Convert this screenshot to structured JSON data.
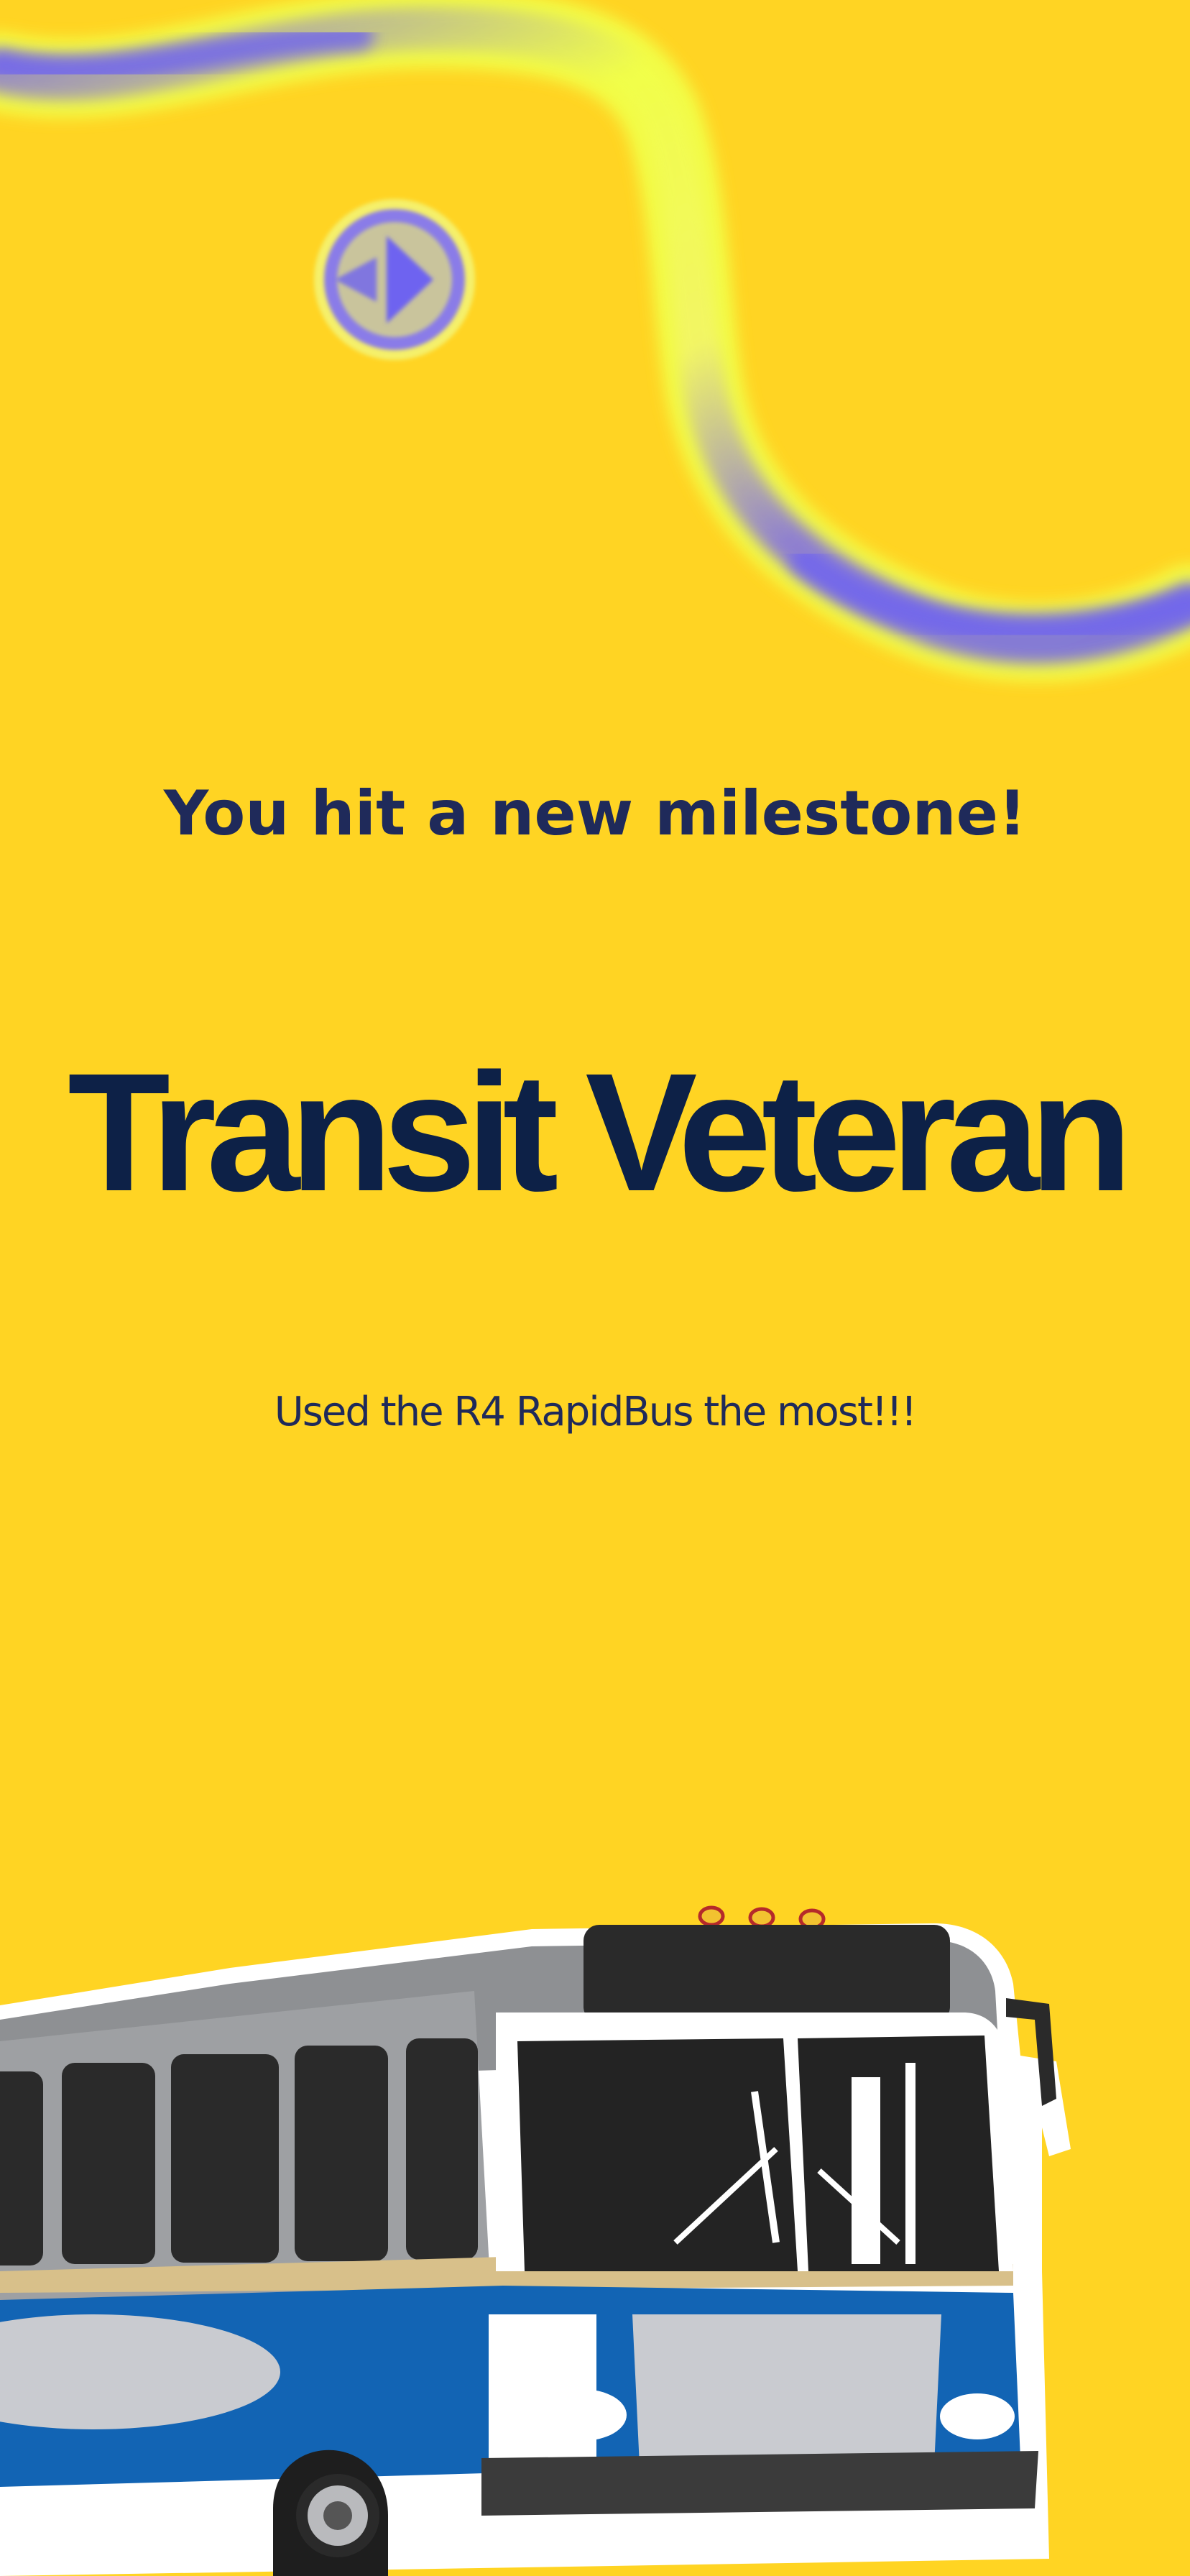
{
  "milestone": {
    "subtitle": "You hit a new milestone!",
    "title": "Transit Veteran",
    "caption": "Used the R4 RapidBus the most!!!"
  },
  "colors": {
    "background": "#FFD423",
    "subtitle": "#1F2A5A",
    "title": "#0D2147",
    "ribbon_accent": "#6E63F0",
    "ribbon_highlight": "#F1FF4A",
    "bus_blue": "#1264B4",
    "bus_gray": "#8E9093"
  },
  "icons": {
    "ribbon": "decorative-ribbon",
    "badge": "milestone-badge-icon",
    "illustration": "bus-illustration"
  }
}
